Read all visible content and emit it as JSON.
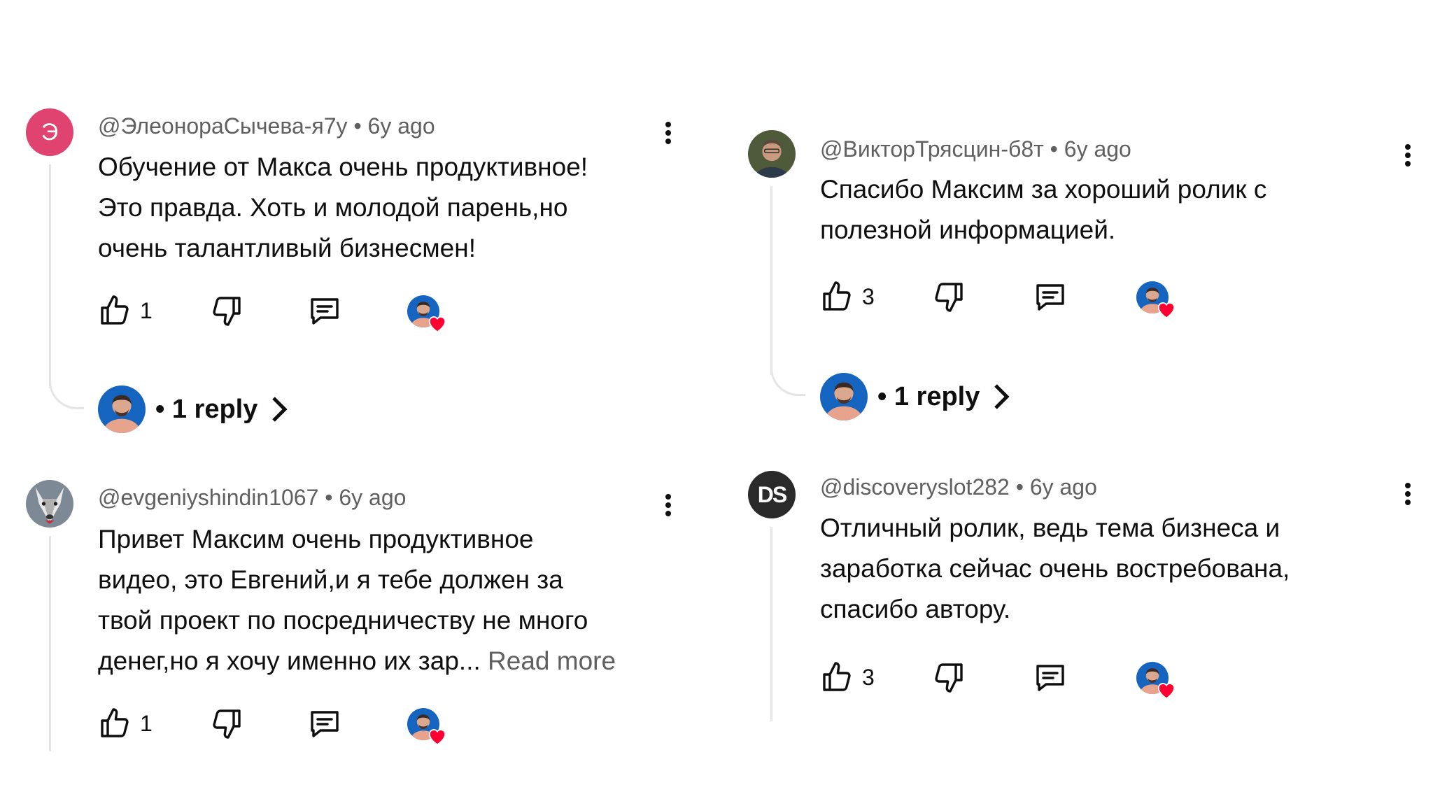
{
  "colors": {
    "text": "#0f0f0f",
    "meta": "#606060",
    "like_heart": "#ff0033",
    "avatar_blue": "#1565c0"
  },
  "comments": [
    {
      "author": "@ЭлеонораСычева-я7у",
      "age": "6y ago",
      "avatar_letter": "Э",
      "lines": [
        "Обучение от Макса очень продуктивное!",
        "Это правда. Хоть и молодой парень,но",
        "очень талантливый бизнесмен!"
      ],
      "likes": "1",
      "reply_text": "• 1 reply"
    },
    {
      "author": "@ВикторТрясцин-б8т",
      "age": "6y ago",
      "lines": [
        "Спасибо Максим за хороший ролик с",
        "полезной информацией."
      ],
      "likes": "3",
      "reply_text": "• 1 reply"
    },
    {
      "author": "@evgeniyshindin1067",
      "age": "6y ago",
      "lines": [
        "Привет Максим очень продуктивное",
        "видео, это Евгений,и я тебе должен за",
        "твой проект по посредничеству не много",
        "денег,но я хочу именно их зар..."
      ],
      "read_more": "Read more",
      "likes": "1"
    },
    {
      "author": "@discoveryslot282",
      "age": "6y ago",
      "avatar_text": "DS",
      "lines": [
        "Отличный ролик, ведь тема бизнеса и",
        "заработка сейчас очень востребована,",
        "спасибо автору."
      ],
      "likes": "3"
    }
  ],
  "icons": {
    "like": "thumb-up-icon",
    "dislike": "thumb-down-icon",
    "reply": "comment-icon",
    "more": "more-vert-icon",
    "heart": "heart-icon",
    "chevron": "chevron-right-icon"
  }
}
